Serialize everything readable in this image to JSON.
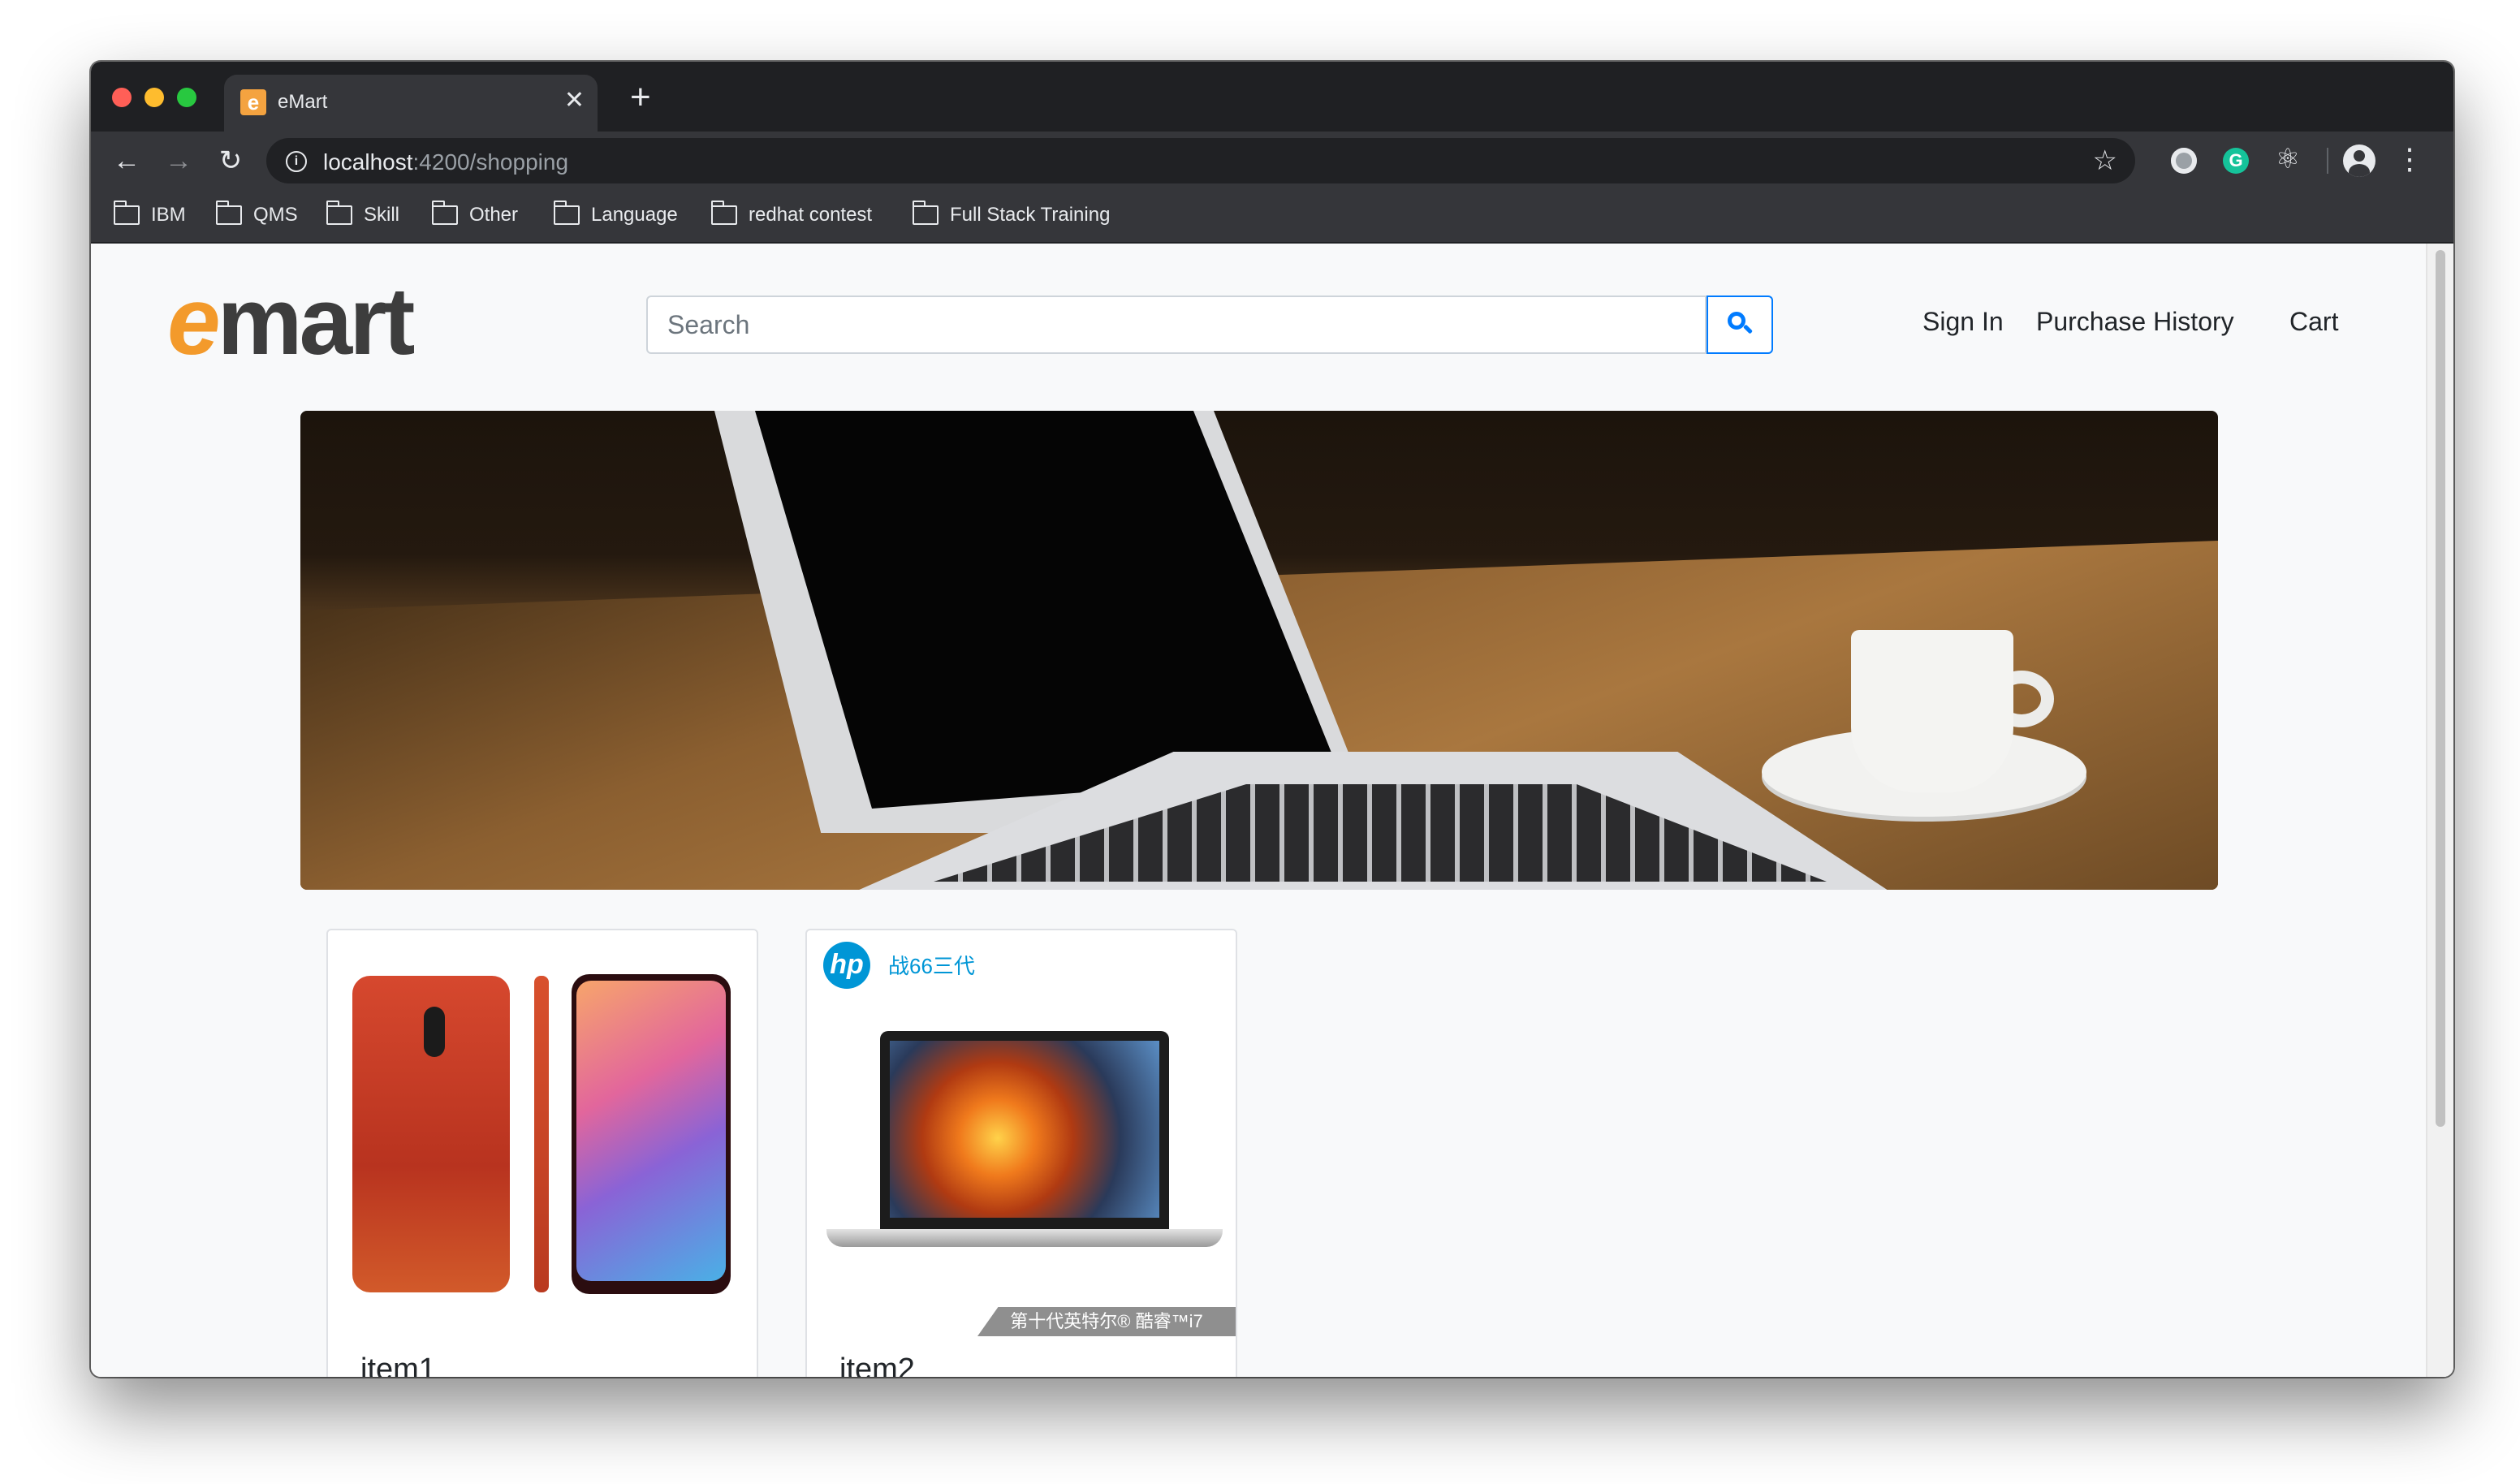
{
  "browser": {
    "tab_title": "eMart",
    "new_tab_label": "+",
    "url_host": "localhost",
    "url_rest": ":4200/shopping",
    "bookmarks": [
      "IBM",
      "QMS",
      "Skill",
      "Other",
      "Language",
      "redhat contest",
      "Full Stack Training"
    ]
  },
  "header": {
    "logo_e": "e",
    "logo_rest": "mart",
    "search_placeholder": "Search",
    "nav": [
      "Sign In",
      "Purchase History",
      "Cart"
    ]
  },
  "products": [
    {
      "title": "item1"
    },
    {
      "title": "item2",
      "brand_tag": "战66三代",
      "ribbon": "第十代英特尔® 酷睿™i7"
    }
  ],
  "colors": {
    "accent": "#007bff",
    "brand_orange": "#f39a2b",
    "hp_blue": "#0096d6"
  },
  "icons": [
    "back-icon",
    "forward-icon",
    "reload-icon",
    "info-icon",
    "star-icon",
    "folder-icon",
    "search-icon",
    "profile-icon",
    "menu-icon"
  ]
}
